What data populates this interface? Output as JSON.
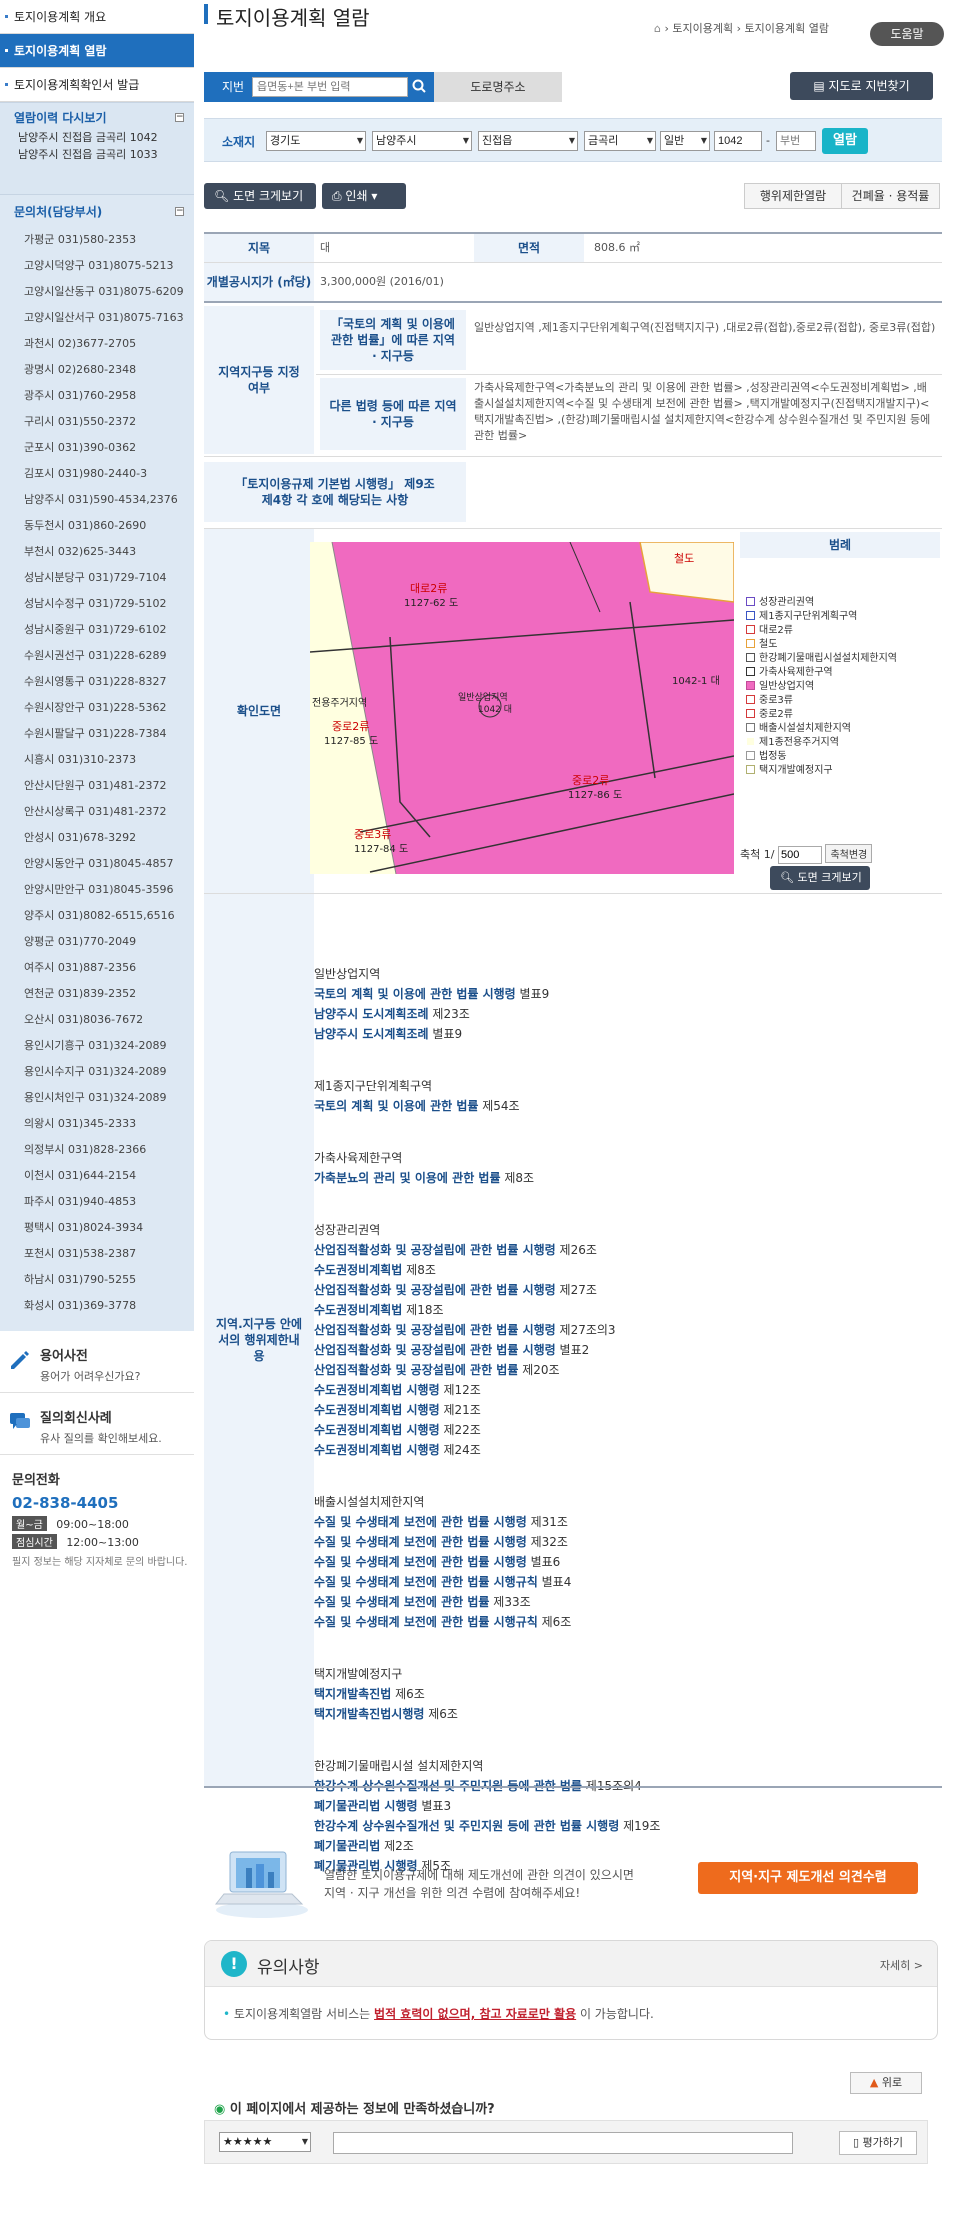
{
  "sidebar": {
    "menu": [
      {
        "label": "토지이용계획 개요",
        "active": false
      },
      {
        "label": "토지이용계획 열람",
        "active": true
      },
      {
        "label": "토지이용계획확인서 발급",
        "active": false
      }
    ],
    "history": {
      "title": "열람이력 다시보기",
      "toggle": "−",
      "items": [
        "남양주시 진접읍 금곡리 1042",
        "남양주시 진접읍 금곡리 1033"
      ]
    },
    "contacts": {
      "title": "문의처(담당부서)",
      "toggle": "−",
      "items": [
        "가평군 031)580-2353",
        "고양시덕양구 031)8075-5213",
        "고양시일산동구 031)8075-6209",
        "고양시일산서구 031)8075-7163",
        "과천시 02)3677-2705",
        "광명시 02)2680-2348",
        "광주시 031)760-2958",
        "구리시 031)550-2372",
        "군포시 031)390-0362",
        "김포시 031)980-2440-3",
        "남양주시 031)590-4534,2376",
        "동두천시 031)860-2690",
        "부천시 032)625-3443",
        "성남시분당구 031)729-7104",
        "성남시수정구 031)729-5102",
        "성남시중원구 031)729-6102",
        "수원시권선구 031)228-6289",
        "수원시영통구 031)228-8327",
        "수원시장안구 031)228-5362",
        "수원시팔달구 031)228-7384",
        "시흥시 031)310-2373",
        "안산시단원구 031)481-2372",
        "안산시상록구 031)481-2372",
        "안성시 031)678-3292",
        "안양시동안구 031)8045-4857",
        "안양시만안구 031)8045-3596",
        "양주시 031)8082-6515,6516",
        "양평군 031)770-2049",
        "여주시 031)887-2356",
        "연천군 031)839-2352",
        "오산시 031)8036-7672",
        "용인시기흥구 031)324-2089",
        "용인시수지구 031)324-2089",
        "용인시처인구 031)324-2089",
        "의왕시 031)345-2333",
        "의정부시 031)828-2366",
        "이천시 031)644-2154",
        "파주시 031)940-4853",
        "평택시 031)8024-3934",
        "포천시 031)538-2387",
        "하남시 031)790-5255",
        "화성시 031)369-3778"
      ]
    },
    "dictionary": {
      "title": "용어사전",
      "desc": "용어가 어려우신가요?"
    },
    "qna": {
      "title": "질의회신사례",
      "desc": "유사 질의를 확인해보세요."
    },
    "phone": {
      "title": "문의전화",
      "number": "02-838-4405",
      "weekday_label": "월~금",
      "weekday_time": "09:00~18:00",
      "lunch_label": "점심시간",
      "lunch_time": "12:00~13:00",
      "note": "필지 정보는 해당 지자체로 문의 바랍니다."
    }
  },
  "header": {
    "title": "토지이용계획 열람",
    "breadcrumb": [
      "토지이용계획",
      "토지이용계획 열람"
    ],
    "help": "도움말"
  },
  "search": {
    "jibun_label": "지번",
    "jibun_placeholder": "읍면동+본 부번 입력",
    "road_tab": "도로명주소",
    "map_find": "지도로 지번찾기"
  },
  "address": {
    "label": "소재지",
    "sido": "경기도",
    "sigungu": "남양주시",
    "eupmyeon": "진접읍",
    "ri": "금곡리",
    "type": "일반",
    "bonbun": "1042",
    "bubun_placeholder": "부번",
    "view": "열람"
  },
  "toolbar": {
    "enlarge": "도면 크게보기",
    "print": "인쇄",
    "restrict": "행위제한열람",
    "building": "건폐율 · 용적률"
  },
  "table": {
    "jimok_label": "지목",
    "jimok_value": "대",
    "area_label": "면적",
    "area_value": "808.6 ㎡",
    "price_label": "개별공시지가 (㎡당)",
    "price_value": "3,300,000원 (2016/01)",
    "zone_label": "지역지구등 지정여부",
    "national_law_label": "「국토의 계획 및 이용에 관한 법률」에 따른 지역 · 지구등",
    "national_law_value": "일반상업지역 ,제1종지구단위계획구역(진접택지지구) ,대로2류(접합),중로2류(접합), 중로3류(접합)",
    "other_law_label": "다른 법령 등에 따른 지역 · 지구등",
    "other_law_value": "가축사육제한구역<가축분뇨의 관리 및 이용에 관한 법률> ,성장관리권역<수도권정비계획법> ,배출시설설치제한지역<수질 및 수생태계 보전에 관한 법률> ,택지개발예정지구(진접택지개발지구)<택지개발촉진법> ,(한강)폐기물매립시설 설치제한지역<한강수계 상수원수질개선 및 주민지원 등에 관한 법률>",
    "basic_law_label": "「토지이용규제 기본법 시행령」 제9조제4항 각 호에 해당되는 사항",
    "basic_law_value": "",
    "map_label": "확인도면",
    "limits_label": "지역.지구등 안에서의 행위제한내용"
  },
  "map": {
    "labels": {
      "road_top": "대로2류",
      "road_top_lot": "1127-62 도",
      "railway": "철도",
      "zone_center": "일반상업지역",
      "lot_center": "1042 대",
      "lot_right": "1042-1 대",
      "zone_left": "전용주거지역",
      "road_left": "중로2류",
      "road_left_lot": "1127-85 도",
      "road_bottom": "중로2류",
      "road_bottom_lot": "1127-86 도",
      "road_corner": "중로3류",
      "road_corner_lot": "1127-84 도"
    },
    "legend_title": "범례",
    "legend": [
      {
        "label": "성장관리권역",
        "color": "#ffffff",
        "border": "#6a4bc4"
      },
      {
        "label": "제1종지구단위계획구역",
        "color": "#ffffff",
        "border": "#3a55c4"
      },
      {
        "label": "대로2류",
        "color": "#ffffff",
        "border": "#d43a3a"
      },
      {
        "label": "철도",
        "color": "#ffffff",
        "border": "#e7a23a"
      },
      {
        "label": "한강폐기물매립시설설치제한지역",
        "color": "#ffffff",
        "border": "#555555"
      },
      {
        "label": "가축사육제한구역",
        "color": "#ffffff",
        "border": "#333333"
      },
      {
        "label": "일반상업지역",
        "color": "#f06ac0",
        "border": "#c24b98"
      },
      {
        "label": "중로3류",
        "color": "#ffffff",
        "border": "#d43a3a"
      },
      {
        "label": "중로2류",
        "color": "#ffffff",
        "border": "#d43a3a"
      },
      {
        "label": "배출시설설치제한지역",
        "color": "#ffffff",
        "border": "#777777"
      },
      {
        "label": "제1종전용주거지역",
        "color": "#ffffe0",
        "border": "#ffffff"
      },
      {
        "label": "법정동",
        "color": "#ffffff",
        "border": "#999999"
      },
      {
        "label": "택지개발예정지구",
        "color": "#ffffff",
        "border": "#b0b070"
      }
    ],
    "scale_label": "축척 1/",
    "scale_value": "500",
    "scale_btn": "축척변경",
    "enlarge_btn": "도면 크게보기"
  },
  "limits": [
    {
      "title": "일반상업지역",
      "items": [
        {
          "link": "국토의 계획 및 이용에 관한 법률 시행령",
          "article": "별표9"
        },
        {
          "link": "남양주시 도시계획조례",
          "article": "제23조"
        },
        {
          "link": "남양주시 도시계획조례",
          "article": "별표9"
        }
      ]
    },
    {
      "title": "제1종지구단위계획구역",
      "items": [
        {
          "link": "국토의 계획 및 이용에 관한 법률",
          "article": "제54조"
        }
      ]
    },
    {
      "title": "가축사육제한구역",
      "items": [
        {
          "link": "가축분뇨의 관리 및 이용에 관한 법률",
          "article": "제8조"
        }
      ]
    },
    {
      "title": "성장관리권역",
      "items": [
        {
          "link": "산업집적활성화 및 공장설립에 관한 법률 시행령",
          "article": "제26조"
        },
        {
          "link": "수도권정비계획법",
          "article": "제8조"
        },
        {
          "link": "산업집적활성화 및 공장설립에 관한 법률 시행령",
          "article": "제27조"
        },
        {
          "link": "수도권정비계획법",
          "article": "제18조"
        },
        {
          "link": "산업집적활성화 및 공장설립에 관한 법률 시행령",
          "article": "제27조의3"
        },
        {
          "link": "산업집적활성화 및 공장설립에 관한 법률 시행령",
          "article": "별표2"
        },
        {
          "link": "산업집적활성화 및 공장설립에 관한 법률",
          "article": "제20조"
        },
        {
          "link": "수도권정비계획법 시행령",
          "article": "제12조"
        },
        {
          "link": "수도권정비계획법 시행령",
          "article": "제21조"
        },
        {
          "link": "수도권정비계획법 시행령",
          "article": "제22조"
        },
        {
          "link": "수도권정비계획법 시행령",
          "article": "제24조"
        }
      ]
    },
    {
      "title": "배출시설설치제한지역",
      "items": [
        {
          "link": "수질 및 수생태계 보전에 관한 법률 시행령",
          "article": "제31조"
        },
        {
          "link": "수질 및 수생태계 보전에 관한 법률 시행령",
          "article": "제32조"
        },
        {
          "link": "수질 및 수생태계 보전에 관한 법률 시행령",
          "article": "별표6"
        },
        {
          "link": "수질 및 수생태계 보전에 관한 법률 시행규칙",
          "article": "별표4"
        },
        {
          "link": "수질 및 수생태계 보전에 관한 법률",
          "article": "제33조"
        },
        {
          "link": "수질 및 수생태계 보전에 관한 법률 시행규칙",
          "article": "제6조"
        }
      ]
    },
    {
      "title": "택지개발예정지구",
      "items": [
        {
          "link": "택지개발촉진법",
          "article": "제6조"
        },
        {
          "link": "택지개발촉진법시행령",
          "article": "제6조"
        }
      ]
    },
    {
      "title": "한강폐기물매립시설 설치제한지역",
      "items": [
        {
          "link": "한강수계 상수원수질개선 및 주민지원 등에 관한 법률",
          "article": "제15조의4"
        },
        {
          "link": "폐기물관리법 시행령",
          "article": "별표3"
        },
        {
          "link": "한강수계 상수원수질개선 및 주민지원 등에 관한 법률 시행령",
          "article": "제19조"
        },
        {
          "link": "폐기물관리법",
          "article": "제2조"
        },
        {
          "link": "폐기물관리법 시행령",
          "article": "제5조"
        }
      ]
    }
  ],
  "banner": {
    "text1": "열람한 토지이용규제에 대해 제도개선에 관한 의견이 있으시면",
    "text2": "지역 · 지구 개선을 위한 의견 수렴에 참여해주세요!",
    "button": "지역·지구 제도개선 의견수렴"
  },
  "notice": {
    "title": "유의사항",
    "more": "자세히 >",
    "text_pre": "토지이용계획열람 서비스는 ",
    "text_em": "법적 효력이 없으며, 참고 자료로만 활용",
    "text_post": "이 가능합니다."
  },
  "top_btn": "위로",
  "survey": {
    "question": "이 페이지에서 제공하는 정보에 만족하셨습니까?",
    "rating": "★★★★★",
    "submit": "평가하기"
  }
}
